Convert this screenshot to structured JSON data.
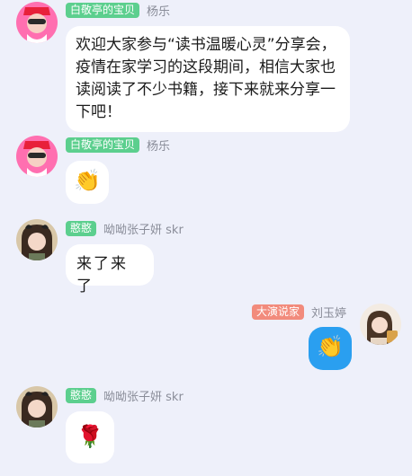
{
  "messages": [
    {
      "badge": "白敬亭的宝贝",
      "sender": "杨乐",
      "badge_color": "#5ccf8e",
      "text": "欢迎大家参与“读书温暖心灵”分享会，疫情在家学习的这段期间，相信大家也读阅读了不少书籍，接下来就来分享一下吧！"
    },
    {
      "badge": "白敬亭的宝贝",
      "sender": "杨乐",
      "badge_color": "#5ccf8e",
      "emoji": "👏"
    },
    {
      "badge": "憨憨",
      "sender": "呦呦张子妍 skr",
      "badge_color": "#5ccf8e",
      "text": "来了来了"
    },
    {
      "badge": "大演说家",
      "sender": "刘玉婷",
      "badge_color": "#f28b7c",
      "emoji": "👏",
      "self_bubble_color": "#2a9ff0"
    },
    {
      "badge": "憨憨",
      "sender": "呦呦张子妍 skr",
      "badge_color": "#5ccf8e",
      "emoji": "🌹"
    }
  ]
}
